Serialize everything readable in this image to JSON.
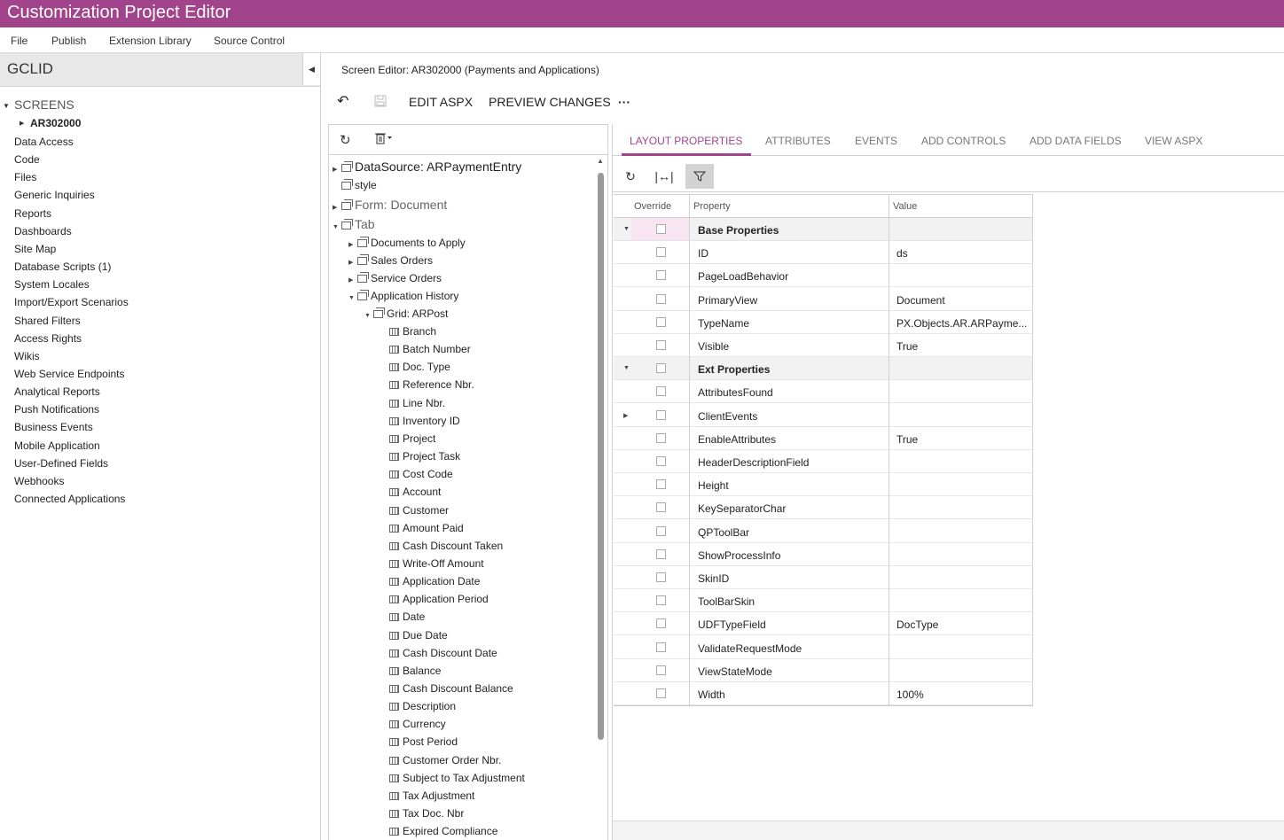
{
  "app": {
    "title": "Customization Project Editor"
  },
  "menu": {
    "file": "File",
    "publish": "Publish",
    "extension_library": "Extension Library",
    "source_control": "Source Control"
  },
  "project": {
    "name": "GCLID"
  },
  "nav": {
    "screens_label": "SCREENS",
    "screen_id": "AR302000",
    "items": [
      "Data Access",
      "Code",
      "Files",
      "Generic Inquiries",
      "Reports",
      "Dashboards",
      "Site Map",
      "Database Scripts (1)",
      "System Locales",
      "Import/Export Scenarios",
      "Shared Filters",
      "Access Rights",
      "Wikis",
      "Web Service Endpoints",
      "Analytical Reports",
      "Push Notifications",
      "Business Events",
      "Mobile Application",
      "User-Defined Fields",
      "Webhooks",
      "Connected Applications"
    ]
  },
  "editor": {
    "title": "Screen Editor: AR302000 (Payments and Applications)",
    "edit_aspx": "EDIT ASPX",
    "preview_changes": "PREVIEW CHANGES",
    "more": "···"
  },
  "icons": {
    "undo": "undo-icon",
    "save": "save-icon",
    "refresh": "refresh-icon",
    "delete": "trash-icon",
    "fit": "fit-width-icon",
    "filter": "filter-icon"
  },
  "tree": {
    "datasource": "DataSource: ARPaymentEntry",
    "style": "style",
    "form": "Form: Document",
    "tab": "Tab",
    "tab_children": [
      "Documents to Apply",
      "Sales Orders",
      "Service Orders",
      "Application History"
    ],
    "grid": "Grid: ARPost",
    "fields": [
      "Branch",
      "Batch Number",
      "Doc. Type",
      "Reference Nbr.",
      "Line Nbr.",
      "Inventory ID",
      "Project",
      "Project Task",
      "Cost Code",
      "Account",
      "Customer",
      "Amount Paid",
      "Cash Discount Taken",
      "Write-Off Amount",
      "Application Date",
      "Application Period",
      "Date",
      "Due Date",
      "Cash Discount Date",
      "Balance",
      "Cash Discount Balance",
      "Description",
      "Currency",
      "Post Period",
      "Customer Order Nbr.",
      "Subject to Tax Adjustment",
      "Tax Adjustment",
      "Tax Doc. Nbr",
      "Expired Compliance"
    ]
  },
  "tabs": [
    "LAYOUT PROPERTIES",
    "ATTRIBUTES",
    "EVENTS",
    "ADD CONTROLS",
    "ADD DATA FIELDS",
    "VIEW ASPX"
  ],
  "grid": {
    "headers": {
      "override": "Override",
      "property": "Property",
      "value": "Value"
    },
    "rows": [
      {
        "property": "Base Properties",
        "value": "",
        "group": true
      },
      {
        "property": "ID",
        "value": "ds"
      },
      {
        "property": "PageLoadBehavior",
        "value": ""
      },
      {
        "property": "PrimaryView",
        "value": "Document"
      },
      {
        "property": "TypeName",
        "value": "PX.Objects.AR.ARPayme..."
      },
      {
        "property": "Visible",
        "value": "True"
      },
      {
        "property": "Ext Properties",
        "value": "",
        "group": true
      },
      {
        "property": "AttributesFound",
        "value": ""
      },
      {
        "property": "ClientEvents",
        "value": "",
        "expandable": true
      },
      {
        "property": "EnableAttributes",
        "value": "True"
      },
      {
        "property": "HeaderDescriptionField",
        "value": ""
      },
      {
        "property": "Height",
        "value": ""
      },
      {
        "property": "KeySeparatorChar",
        "value": ""
      },
      {
        "property": "QPToolBar",
        "value": ""
      },
      {
        "property": "ShowProcessInfo",
        "value": ""
      },
      {
        "property": "SkinID",
        "value": ""
      },
      {
        "property": "ToolBarSkin",
        "value": ""
      },
      {
        "property": "UDFTypeField",
        "value": "DocType"
      },
      {
        "property": "ValidateRequestMode",
        "value": ""
      },
      {
        "property": "ViewStateMode",
        "value": ""
      },
      {
        "property": "Width",
        "value": "100%"
      }
    ]
  },
  "colors": {
    "brand": "#a2448c",
    "selected_row": "#f7e6f2"
  }
}
